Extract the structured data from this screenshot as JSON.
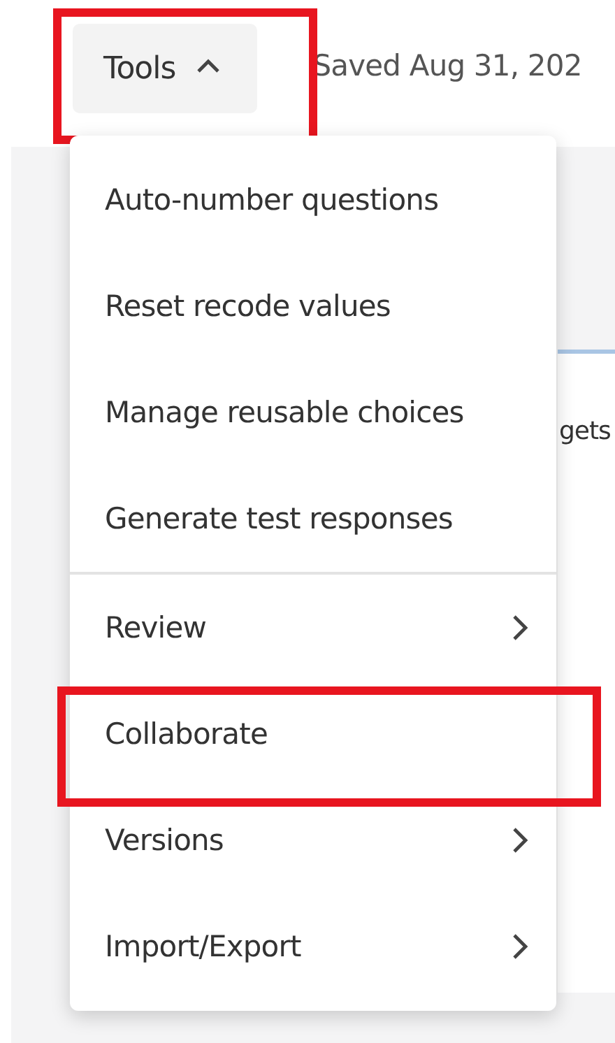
{
  "toolbar": {
    "tools_button": {
      "label": "Tools",
      "expanded": true,
      "highlighted": true
    },
    "save_status": "Saved Aug 31, 202"
  },
  "background_panel": {
    "texts": [
      "gets"
    ]
  },
  "menu": {
    "sections": [
      [
        {
          "label": "Auto-number questions",
          "kind": "action",
          "highlighted": false
        },
        {
          "label": "Reset recode values",
          "kind": "action",
          "highlighted": false
        },
        {
          "label": "Manage reusable choices",
          "kind": "action",
          "highlighted": false
        },
        {
          "label": "Generate test responses",
          "kind": "action",
          "highlighted": false
        }
      ],
      [
        {
          "label": "Review",
          "kind": "submenu",
          "highlighted": false
        },
        {
          "label": "Collaborate",
          "kind": "action",
          "highlighted": true
        },
        {
          "label": "Versions",
          "kind": "submenu",
          "highlighted": false
        },
        {
          "label": "Import/Export",
          "kind": "submenu",
          "highlighted": false
        }
      ]
    ]
  }
}
